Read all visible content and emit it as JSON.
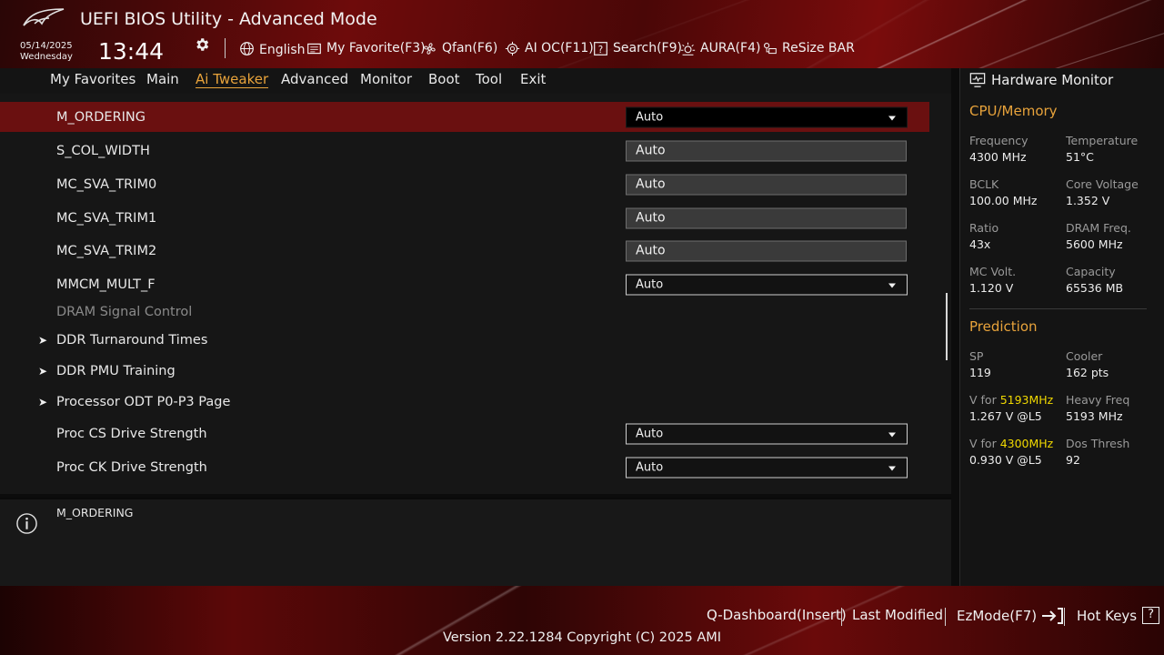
{
  "header": {
    "title": "UEFI BIOS Utility - Advanced Mode",
    "date": "05/14/2025",
    "weekday": "Wednesday",
    "time": "13:44",
    "toolbar": {
      "language": "English",
      "my_favorite": "My Favorite(F3)",
      "qfan": "Qfan(F6)",
      "ai_oc": "AI OC(F11)",
      "search": "Search(F9)",
      "aura": "AURA(F4)",
      "resize_bar": "ReSize BAR"
    }
  },
  "nav": {
    "tabs": [
      {
        "label": "My Favorites"
      },
      {
        "label": "Main"
      },
      {
        "label": "Ai Tweaker",
        "active": true
      },
      {
        "label": "Advanced"
      },
      {
        "label": "Monitor"
      },
      {
        "label": "Boot"
      },
      {
        "label": "Tool"
      },
      {
        "label": "Exit"
      }
    ]
  },
  "settings": [
    {
      "label": "M_ORDERING",
      "value": "Auto",
      "kind": "dropdown",
      "selected": true
    },
    {
      "label": "S_COL_WIDTH",
      "value": "Auto",
      "kind": "field"
    },
    {
      "label": "MC_SVA_TRIM0",
      "value": "Auto",
      "kind": "field"
    },
    {
      "label": "MC_SVA_TRIM1",
      "value": "Auto",
      "kind": "field"
    },
    {
      "label": "MC_SVA_TRIM2",
      "value": "Auto",
      "kind": "field"
    },
    {
      "label": "MMCM_MULT_F",
      "value": "Auto",
      "kind": "dropdown"
    },
    {
      "label": "DRAM Signal Control",
      "kind": "header"
    },
    {
      "label": "DDR Turnaround Times",
      "kind": "submenu"
    },
    {
      "label": "DDR PMU Training",
      "kind": "submenu"
    },
    {
      "label": "Processor ODT P0-P3 Page",
      "kind": "submenu"
    },
    {
      "label": "Proc CS Drive Strength",
      "value": "Auto",
      "kind": "dropdown"
    },
    {
      "label": "Proc CK Drive Strength",
      "value": "Auto",
      "kind": "dropdown"
    }
  ],
  "info": {
    "text": "M_ORDERING"
  },
  "hardware_monitor": {
    "title": "Hardware Monitor",
    "cpu_memory": {
      "section": "CPU/Memory",
      "items": [
        {
          "label": "Frequency",
          "value": "4300 MHz"
        },
        {
          "label": "Temperature",
          "value": "51°C"
        },
        {
          "label": "BCLK",
          "value": "100.00 MHz"
        },
        {
          "label": "Core Voltage",
          "value": "1.352 V"
        },
        {
          "label": "Ratio",
          "value": "43x"
        },
        {
          "label": "DRAM Freq.",
          "value": "5600 MHz"
        },
        {
          "label": "MC Volt.",
          "value": "1.120 V"
        },
        {
          "label": "Capacity",
          "value": "65536 MB"
        }
      ]
    },
    "prediction": {
      "section": "Prediction",
      "sp_label": "SP",
      "sp_value": "119",
      "cooler_label": "Cooler",
      "cooler_value": "162 pts",
      "vfor1_prefix": "V for ",
      "vfor1_freq": "5193MHz",
      "vfor1_value": "1.267 V @L5",
      "heavy_label": "Heavy Freq",
      "heavy_value": "5193 MHz",
      "vfor2_prefix": "V for ",
      "vfor2_freq": "4300MHz",
      "vfor2_value": "0.930 V @L5",
      "dos_label": "Dos Thresh",
      "dos_value": "92"
    }
  },
  "footer": {
    "q_dashboard": "Q-Dashboard(Insert)",
    "last_modified": "Last Modified",
    "ezmode": "EzMode(F7)",
    "hot_keys": "Hot Keys",
    "hot_keys_icon": "?",
    "version": "Version 2.22.1284 Copyright (C) 2025 AMI"
  },
  "colors": {
    "accent": "#e8a33b",
    "selected_row": "#6a1010",
    "highlight_freq": "#f0d800"
  }
}
